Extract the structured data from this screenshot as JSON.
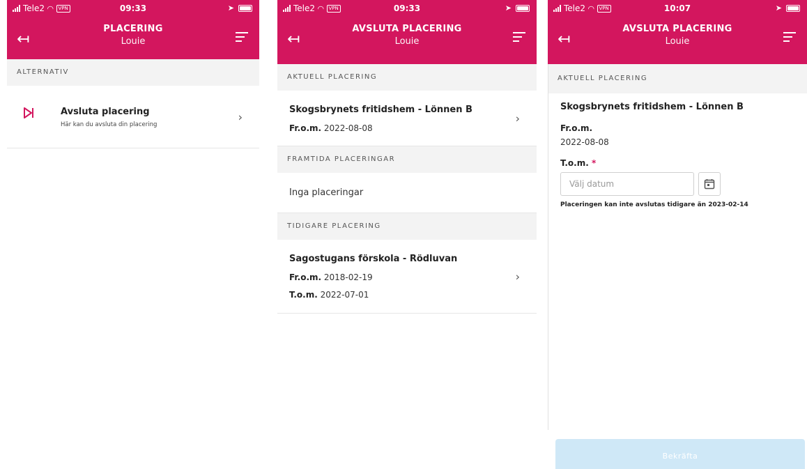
{
  "colors": {
    "brand": "#d3165e",
    "confirm_disabled": "#cfe8f7"
  },
  "screen1": {
    "status": {
      "carrier": "Tele2",
      "vpn": "VPN",
      "time": "09:33"
    },
    "header": {
      "title": "PLACERING",
      "subtitle": "Louie"
    },
    "section": "ALTERNATIV",
    "option": {
      "icon": "end-placement-icon",
      "title": "Avsluta placering",
      "description": "Här kan du avsluta din placering"
    }
  },
  "screen2": {
    "status": {
      "carrier": "Tele2",
      "vpn": "VPN",
      "time": "09:33"
    },
    "header": {
      "title": "AVSLUTA PLACERING",
      "subtitle": "Louie"
    },
    "current": {
      "section": "AKTUELL PLACERING",
      "name": "Skogsbrynets fritidshem - Lönnen B",
      "from_label": "Fr.o.m.",
      "from_value": "2022-08-08"
    },
    "future": {
      "section": "FRAMTIDA PLACERINGAR",
      "empty": "Inga placeringar"
    },
    "previous": {
      "section": "TIDIGARE PLACERING",
      "name": "Sagostugans förskola - Rödluvan",
      "from_label": "Fr.o.m.",
      "from_value": "2018-02-19",
      "to_label": "T.o.m.",
      "to_value": "2022-07-01"
    }
  },
  "screen3": {
    "status": {
      "carrier": "Tele2",
      "vpn": "VPN",
      "time": "10:07"
    },
    "header": {
      "title": "AVSLUTA PLACERING",
      "subtitle": "Louie"
    },
    "section": "AKTUELL PLACERING",
    "name": "Skogsbrynets fritidshem - Lönnen B",
    "from_label": "Fr.o.m.",
    "from_value": "2022-08-08",
    "to_label": "T.o.m.",
    "required_mark": "*",
    "date_placeholder": "Välj datum",
    "hint": "Placeringen kan inte avslutas tidigare än 2023-02-14",
    "confirm_label": "Bekräfta"
  }
}
